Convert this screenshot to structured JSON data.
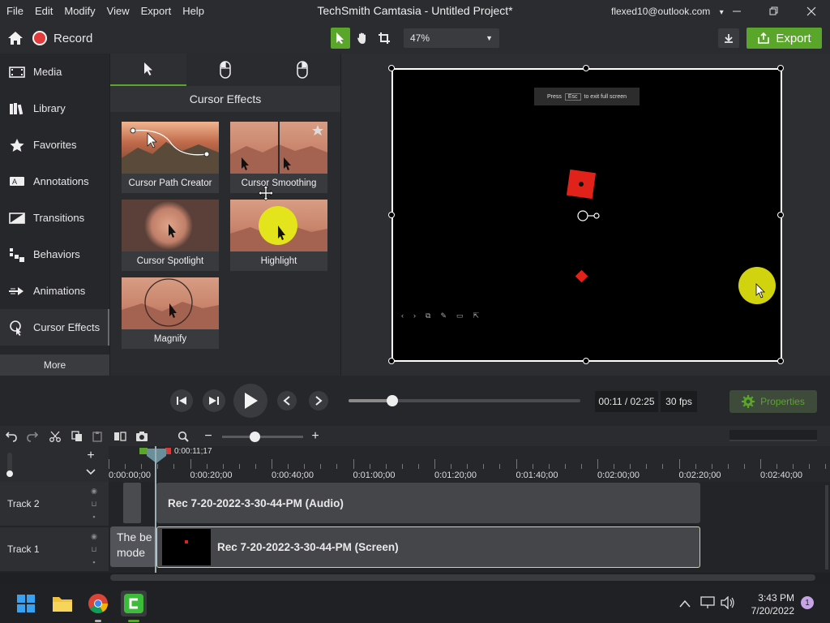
{
  "titlebar": {
    "menu": [
      "File",
      "Edit",
      "Modify",
      "View",
      "Export",
      "Help"
    ],
    "title": "TechSmith Camtasia - Untitled Project*",
    "account": "flexed10@outlook.com",
    "account_caret": "▾"
  },
  "toolbar": {
    "record_label": "Record",
    "zoom": "47%",
    "export_label": "Export"
  },
  "sidebar": {
    "items": [
      {
        "label": "Media"
      },
      {
        "label": "Library"
      },
      {
        "label": "Favorites"
      },
      {
        "label": "Annotations"
      },
      {
        "label": "Transitions"
      },
      {
        "label": "Behaviors"
      },
      {
        "label": "Animations"
      },
      {
        "label": "Cursor Effects"
      }
    ],
    "more_label": "More"
  },
  "panel": {
    "title": "Cursor Effects",
    "effects": [
      {
        "label": "Cursor Path Creator"
      },
      {
        "label": "Cursor Smoothing"
      },
      {
        "label": "Cursor Spotlight"
      },
      {
        "label": "Highlight"
      },
      {
        "label": "Magnify"
      }
    ]
  },
  "canvas": {
    "esc_press": "Press",
    "esc_key": "Esc",
    "esc_text": "to exit full screen"
  },
  "playback": {
    "time": "00:11 / 02:25",
    "fps": "30 fps",
    "properties_label": "Properties",
    "progress": 0.19
  },
  "timeline": {
    "playhead_time": "0:00:11;17",
    "ticks": [
      "0:00:00;00",
      "0:00:20;00",
      "0:00:40;00",
      "0:01:00;00",
      "0:01:20;00",
      "0:01:40;00",
      "0:02:00;00",
      "0:02:20;00",
      "0:02:40;00"
    ],
    "tracks": [
      {
        "name": "Track 2",
        "clip": "Rec 7-20-2022-3-30-44-PM (Audio)"
      },
      {
        "name": "Track 1",
        "clip": "Rec 7-20-2022-3-30-44-PM (Screen)",
        "text_clip": "The be mode"
      }
    ],
    "text_clip_line1": "The be",
    "text_clip_line2": "mode"
  },
  "taskbar": {
    "time": "3:43 PM",
    "date": "7/20/2022",
    "notifications": "1"
  },
  "colors": {
    "accent_green": "#5aa62a",
    "record_red": "#e23b3b",
    "highlight_yellow": "#e3e41c"
  }
}
